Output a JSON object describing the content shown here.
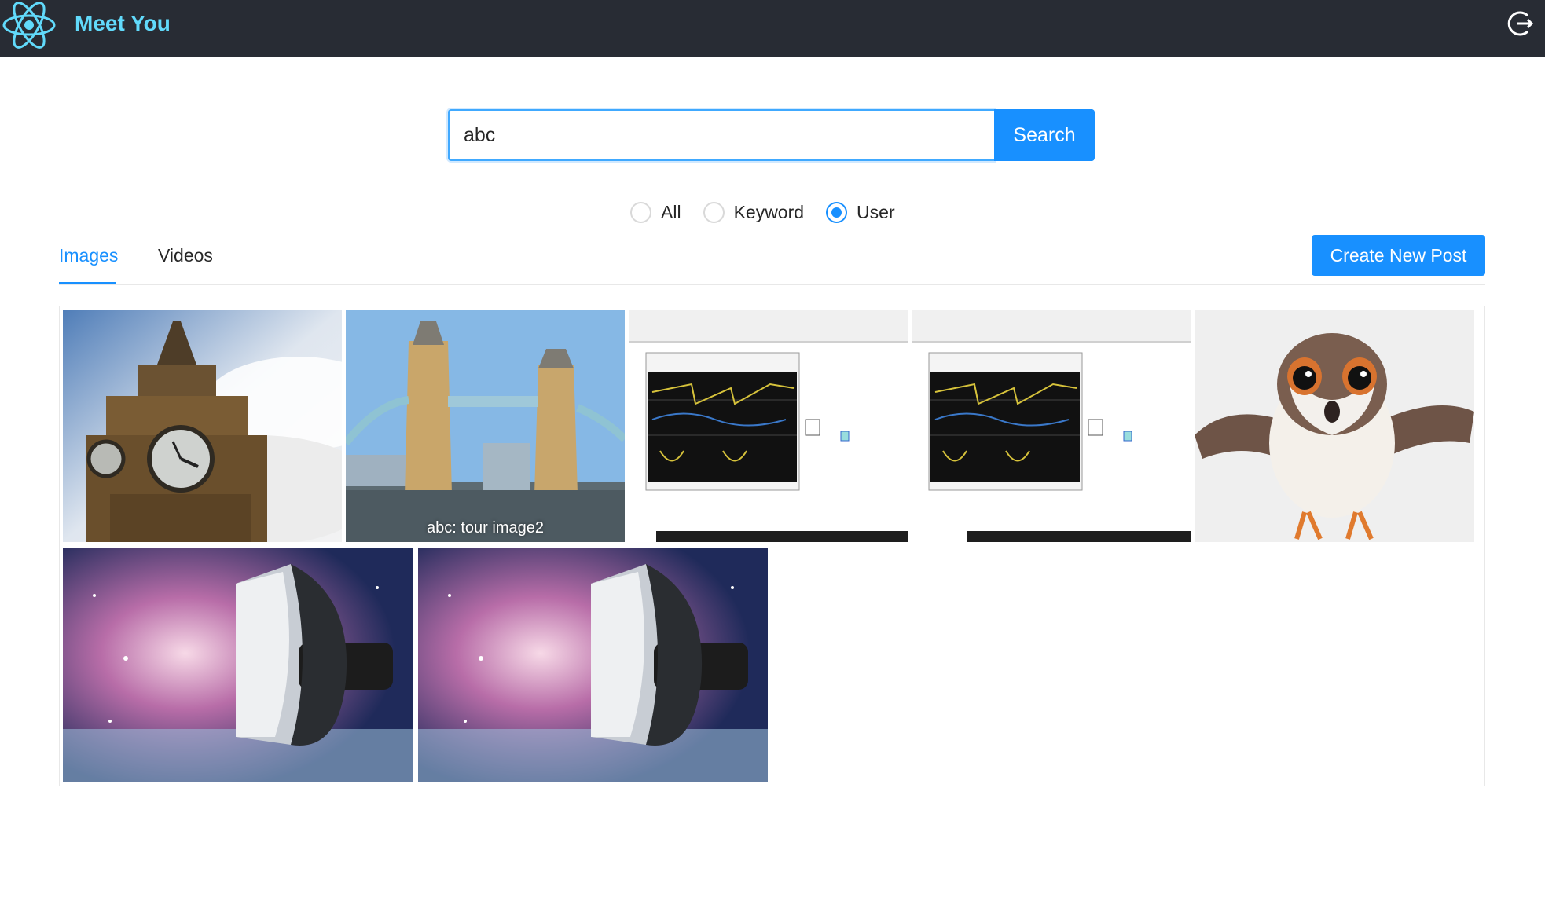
{
  "header": {
    "title": "Meet You",
    "logo_icon": "react-atom-icon",
    "logout_icon": "logout-icon",
    "background": "#282c34",
    "accent": "#61dafb"
  },
  "search": {
    "value": "abc",
    "button_label": "Search"
  },
  "filters": {
    "options": [
      "All",
      "Keyword",
      "User"
    ],
    "selected": "User"
  },
  "tabs": {
    "items": [
      "Images",
      "Videos"
    ],
    "active": "Images"
  },
  "create_post_label": "Create New Post",
  "gallery": {
    "images": [
      {
        "subject": "clock tower",
        "caption": ""
      },
      {
        "subject": "tower bridge",
        "caption": "abc: tour image2"
      },
      {
        "subject": "scope window screenshot",
        "caption": ""
      },
      {
        "subject": "scope window screenshot",
        "caption": ""
      },
      {
        "subject": "porg figure",
        "caption": ""
      },
      {
        "subject": "vr headset in space",
        "caption": ""
      },
      {
        "subject": "vr headset in space",
        "caption": ""
      }
    ]
  },
  "colors": {
    "primary": "#1890ff",
    "border": "#e8e8e8"
  }
}
